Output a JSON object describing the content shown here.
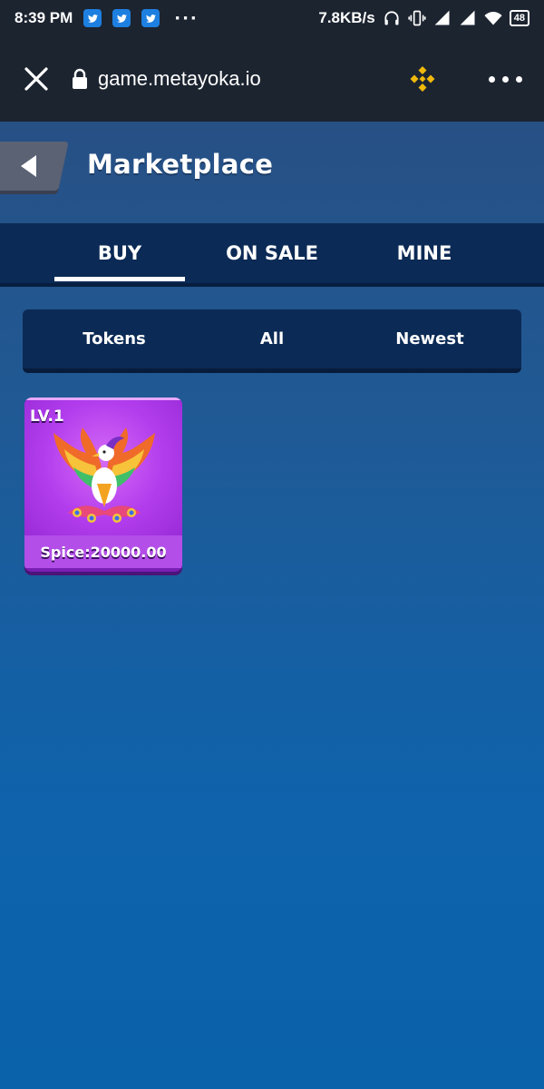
{
  "status_bar": {
    "time": "8:39 PM",
    "notification_icons": [
      "twitter-icon",
      "twitter-icon",
      "twitter-icon"
    ],
    "more": "···",
    "net_speed": "7.8KB/s",
    "battery": "48"
  },
  "browser": {
    "url": "game.metayoka.io",
    "brand_color": "#f0b90b"
  },
  "header": {
    "title": "Marketplace"
  },
  "tabs": [
    {
      "label": "BUY",
      "active": true
    },
    {
      "label": "ON SALE",
      "active": false
    },
    {
      "label": "MINE",
      "active": false
    }
  ],
  "filters": {
    "type": "Tokens",
    "category": "All",
    "sort": "Newest"
  },
  "items": [
    {
      "level": "LV.1",
      "price": "Spice:20000.00",
      "icon": "phoenix-icon"
    }
  ],
  "colors": {
    "card_bg": "#b23ded",
    "tab_bar": "#0b2a55"
  }
}
